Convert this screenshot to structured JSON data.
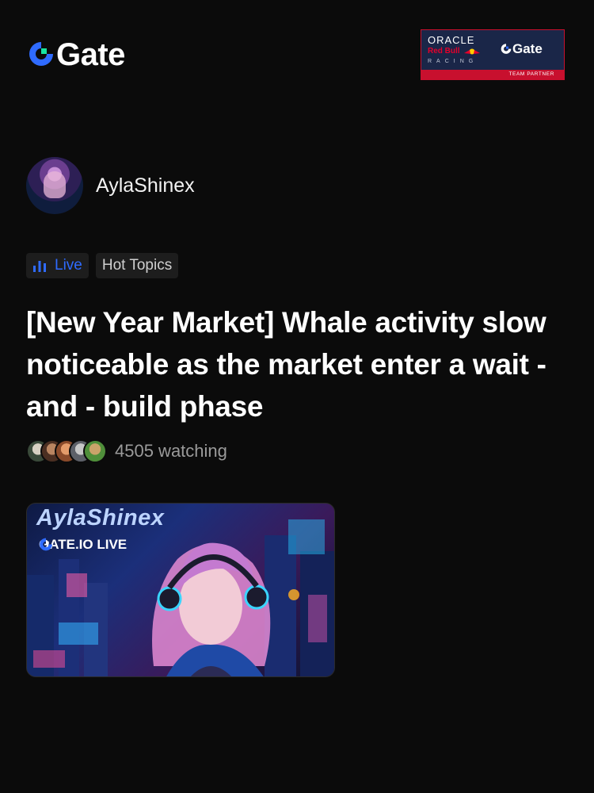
{
  "header": {
    "brand": "Gate",
    "partner": {
      "line1": "ORACLE",
      "line2": "Red Bull",
      "line3": "RACING",
      "gate": "Gate",
      "badge": "TEAM PARTNER"
    }
  },
  "host": {
    "name": "AylaShinex"
  },
  "tags": {
    "live": "Live",
    "topic": "Hot Topics"
  },
  "post": {
    "title": "[New Year Market] Whale activity slow noticeable as the market enter a wait - and - build phase",
    "watching": "4505 watching"
  },
  "cover": {
    "name": "AylaShinex",
    "badge": "GATE.IO LIVE"
  },
  "colors": {
    "background": "#0b0b0b",
    "accent_blue": "#2f6bff",
    "brand_green": "#17e5a3",
    "partner_navy": "#1a2648",
    "partner_red": "#c8102e"
  },
  "icons": {
    "brand": "gate-logo-icon",
    "live": "bar-chart-icon",
    "bull": "red-bull-icon"
  }
}
